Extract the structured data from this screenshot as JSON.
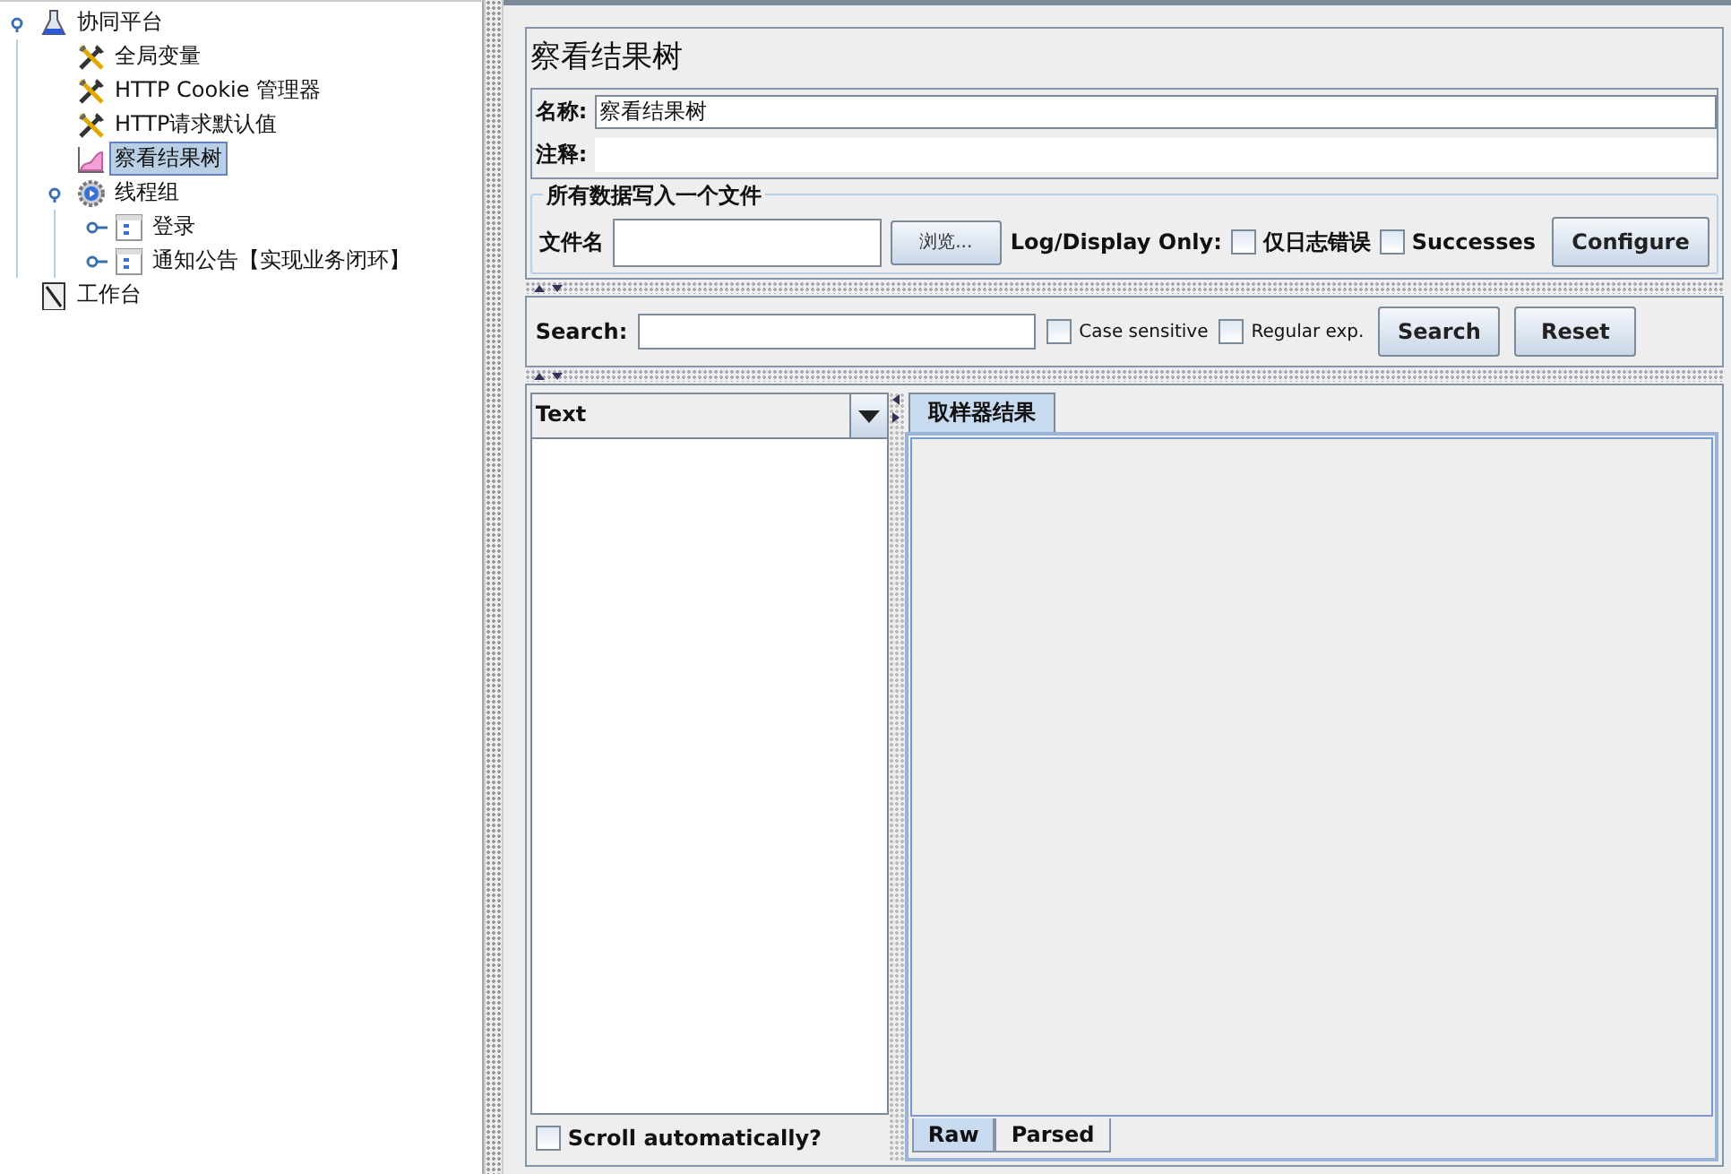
{
  "tree": [
    {
      "label": "协同平台",
      "kind": "testplan",
      "selected": false,
      "expanded": true,
      "children": [
        {
          "label": "全局变量",
          "kind": "config",
          "selected": false
        },
        {
          "label": "HTTP Cookie 管理器",
          "kind": "config",
          "selected": false
        },
        {
          "label": "HTTP请求默认值",
          "kind": "config",
          "selected": false
        },
        {
          "label": "察看结果树",
          "kind": "listener",
          "selected": true
        },
        {
          "label": "线程组",
          "kind": "threadgroup",
          "selected": false,
          "expanded": true,
          "children": [
            {
              "label": "登录",
              "kind": "controller",
              "selected": false,
              "expanded": false
            },
            {
              "label": "通知公告【实现业务闭环】",
              "kind": "controller",
              "selected": false,
              "expanded": false
            }
          ]
        }
      ]
    },
    {
      "label": "工作台",
      "kind": "workbench",
      "selected": false
    }
  ],
  "panel": {
    "title": "察看结果树",
    "name_label": "名称:",
    "name_value": "察看结果树",
    "comment_label": "注释:"
  },
  "file_group": {
    "title": "所有数据写入一个文件",
    "file_label": "文件名",
    "browse": "浏览...",
    "log_label": "Log/Display Only:",
    "options": [
      {
        "label": "仅日志错误",
        "checked": false
      },
      {
        "label": "Successes",
        "checked": false
      }
    ],
    "configure": "Configure"
  },
  "search": {
    "label": "Search:",
    "options": [
      {
        "label": "Case sensitive",
        "checked": false
      },
      {
        "label": "Regular exp.",
        "checked": false
      }
    ],
    "search_button": "Search",
    "reset_button": "Reset"
  },
  "results": {
    "renderer": "Text",
    "scroll_auto": {
      "label": "Scroll automatically?",
      "checked": false
    },
    "tabs": [
      {
        "label": "取样器结果",
        "selected": true
      }
    ],
    "bottom_tabs": [
      {
        "label": "Raw",
        "selected": true
      },
      {
        "label": "Parsed",
        "selected": false
      }
    ]
  }
}
